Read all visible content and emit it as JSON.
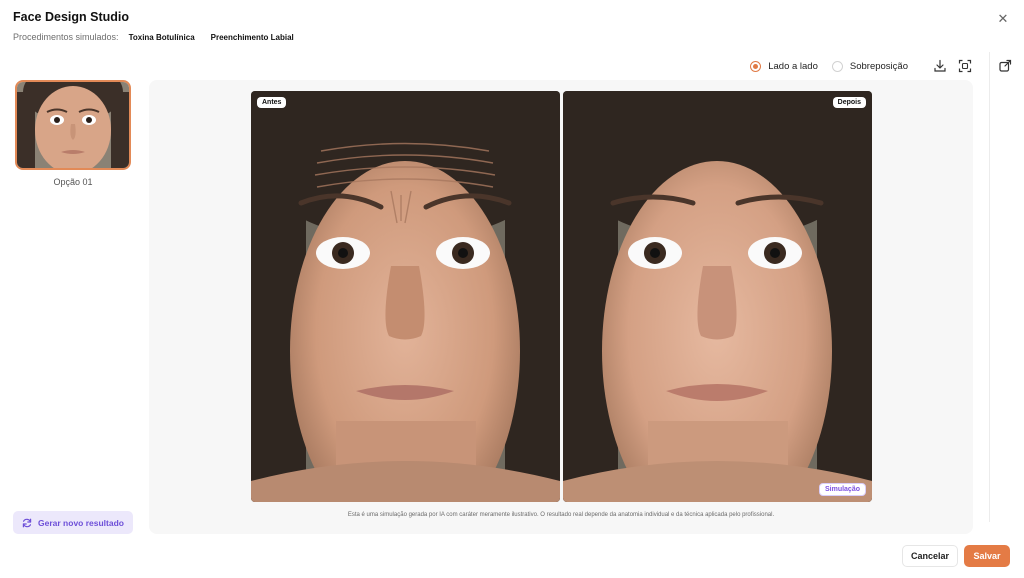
{
  "header": {
    "title": "Face Design Studio",
    "procedures_label": "Procedimentos simulados:",
    "procedures": [
      "Toxina Botulínica",
      "Preenchimento Labial"
    ],
    "close_icon": "close-icon"
  },
  "toolbar": {
    "view_modes": [
      {
        "label": "Lado a lado",
        "selected": true
      },
      {
        "label": "Sobreposição",
        "selected": false
      }
    ],
    "icons": [
      "download-icon",
      "fullscreen-icon"
    ]
  },
  "sidebar": {
    "options": [
      {
        "label": "Opção 01",
        "selected": true
      }
    ],
    "regenerate_label": "Gerar novo resultado"
  },
  "comparison": {
    "before_label": "Antes",
    "after_label": "Depois",
    "simulation_badge": "Simulação",
    "disclaimer": "Esta é uma simulação gerada por IA com caráter meramente ilustrativo. O resultado real depende da anatomia individual e da técnica aplicada pelo profissional."
  },
  "footer": {
    "cancel_label": "Cancelar",
    "save_label": "Salvar"
  },
  "colors": {
    "accent": "#e47b45",
    "regenerate_text": "#6d4fd8",
    "regenerate_bg": "#ece8fb"
  }
}
